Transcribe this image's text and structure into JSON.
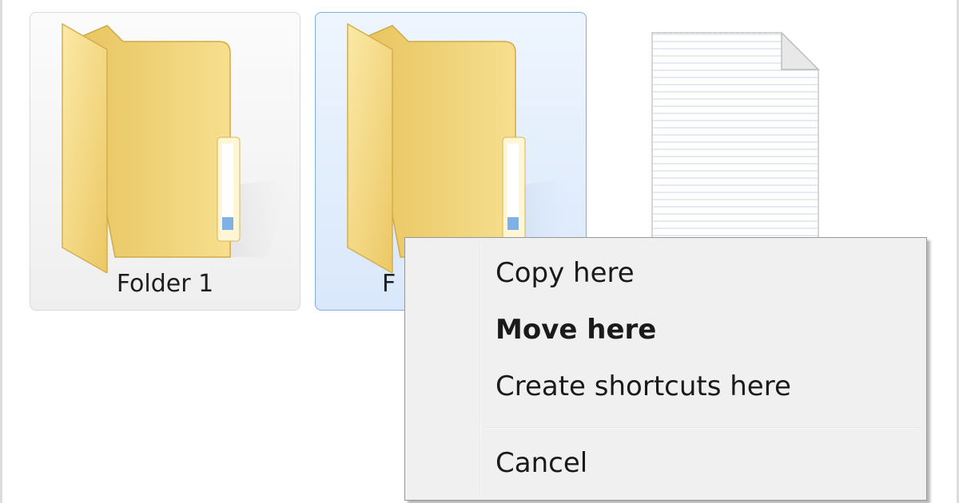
{
  "items": [
    {
      "label": "Folder 1",
      "type": "folder",
      "state": "hover"
    },
    {
      "label": "F",
      "type": "folder",
      "state": "selected"
    },
    {
      "label": "",
      "type": "text-file",
      "state": "normal"
    }
  ],
  "context_menu": {
    "items": [
      {
        "label": "Copy here",
        "default": false
      },
      {
        "label": "Move here",
        "default": true
      },
      {
        "label": "Create shortcuts here",
        "default": false
      },
      {
        "label": "Cancel",
        "default": false
      }
    ]
  },
  "icons": {
    "folder": "folder-icon",
    "file": "text-document-icon"
  },
  "colors": {
    "selection_border": "#84acdd",
    "selection_fill": "#d9e8fb",
    "folder_yellow": "#f2d77c",
    "menu_background": "#f0f0f0"
  }
}
